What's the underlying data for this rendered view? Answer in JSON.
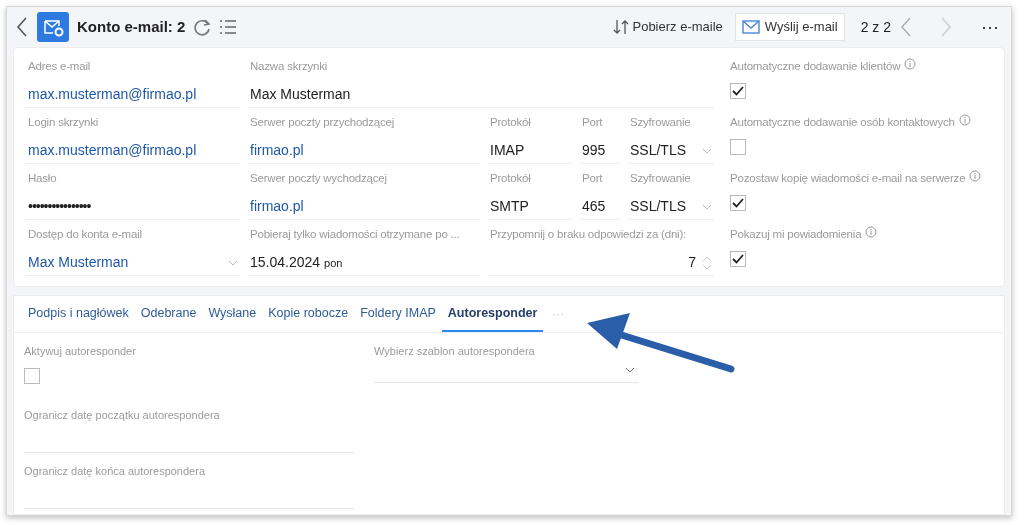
{
  "header": {
    "title": "Konto e-mail: 2",
    "fetch_button": "Pobierz e-maile",
    "send_button": "Wyślij e-mail",
    "pager": "2 z 2",
    "more": "⋯"
  },
  "form_rows": [
    [
      {
        "label": "Adres e-mail",
        "value": "max.musterman@firmao.pl",
        "kind": "link"
      },
      {
        "label": "Nazwa skrzynki",
        "value": "Max Musterman",
        "kind": "text"
      }
    ],
    [
      {
        "label": "Login skrzynki",
        "value": "max.musterman@firmao.pl",
        "kind": "link"
      },
      {
        "label": "Serwer poczty przychodzącej",
        "value": "firmao.pl",
        "kind": "link"
      },
      {
        "label": "Protokół",
        "value": "IMAP",
        "kind": "text"
      },
      {
        "label": "Port",
        "value": "995",
        "kind": "text"
      },
      {
        "label": "Szyfrowanie",
        "value": "SSL/TLS",
        "kind": "select"
      }
    ],
    [
      {
        "label": "Hasło",
        "value": "••••••••••••••••",
        "kind": "password"
      },
      {
        "label": "Serwer poczty wychodzącej",
        "value": "firmao.pl",
        "kind": "link"
      },
      {
        "label": "Protokół",
        "value": "SMTP",
        "kind": "text"
      },
      {
        "label": "Port",
        "value": "465",
        "kind": "text"
      },
      {
        "label": "Szyfrowanie",
        "value": "SSL/TLS",
        "kind": "select"
      }
    ],
    [
      {
        "label": "Dostęp do konta e-mail",
        "value": "Max Musterman",
        "kind": "select",
        "link": true
      },
      {
        "label": "Pobieraj tylko wiadomości otrzymane po ...",
        "value": "15.04.2024",
        "suffix": "pon",
        "kind": "date"
      },
      {
        "label": "Przypomnij o braku odpowiedzi za (dni):",
        "value": "7",
        "kind": "number"
      }
    ]
  ],
  "options": [
    {
      "label": "Automatyczne dodawanie klientów",
      "checked": true
    },
    {
      "label": "Automatyczne dodawanie osób kontaktowych",
      "checked": false
    },
    {
      "label": "Pozostaw kopię wiadomości e-mail na serwerze",
      "checked": true
    },
    {
      "label": "Pokazuj mi powiadomienia",
      "checked": true
    }
  ],
  "tabs": [
    {
      "label": "Podpis i nagłówek",
      "selected": false
    },
    {
      "label": "Odebrane",
      "selected": false
    },
    {
      "label": "Wysłane",
      "selected": false
    },
    {
      "label": "Kopie robocze",
      "selected": false
    },
    {
      "label": "Foldery IMAP",
      "selected": false
    },
    {
      "label": "Autoresponder",
      "selected": true
    }
  ],
  "tabs_more": "···",
  "autoresponder": {
    "activate": {
      "label": "Aktywuj autoresponder",
      "checked": false
    },
    "template": {
      "label": "Wybierz szablon autorespondera"
    },
    "date_fields": [
      {
        "label": "Ogranicz datę początku autorespondera"
      },
      {
        "label": "Ogranicz datę końca autorespondera"
      }
    ]
  }
}
